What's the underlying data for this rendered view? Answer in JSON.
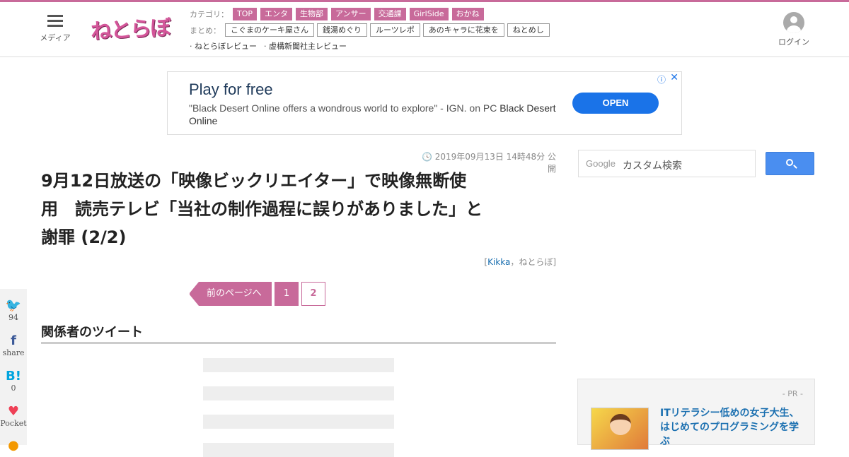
{
  "header": {
    "menu_label": "メディア",
    "logo_text": "ねとらぼ",
    "category_key": "カテゴリ：",
    "categories": [
      "TOP",
      "エンタ",
      "生物部",
      "アンサー",
      "交通課",
      "GirlSide",
      "おかね"
    ],
    "matome_key": "まとめ：",
    "matome": [
      "こぐまのケーキ屋さん",
      "銭湯めぐり",
      "ルーツレポ",
      "あのキャラに花束を",
      "ねとめし"
    ],
    "links": [
      "· ねとらぼレビュー",
      "· 虚構新聞社主レビュー"
    ],
    "login_label": "ログイン"
  },
  "ad": {
    "title": "Play for free",
    "desc_quote": "\"Black Desert Online offers a wondrous world to explore\" - IGN. on PC",
    "desc_brand": "Black Desert Online",
    "cta": "OPEN",
    "info_icon": "ⓘ",
    "close_icon": "✕"
  },
  "article": {
    "date": "2019年09月13日 14時48分 公開",
    "title_lines": [
      "9月12日放送の「映像ビックリエイター」で映像無断使",
      "用　読売テレビ「当社の制作過程に誤りがありました」と",
      "謝罪 (2/2)"
    ],
    "byline_open": "[",
    "byline_author": "Kikka",
    "byline_rest": "，ねとらぼ]",
    "prev_label": "前のページへ",
    "pages": [
      "1",
      "2"
    ],
    "section_title": "関係者のツイート"
  },
  "share": {
    "twitter_count": "94",
    "facebook_label": "share",
    "hatena_icon": "B!",
    "hatena_count": "0",
    "pocket_label": "Pocket"
  },
  "sidebar": {
    "search_brand": "Google",
    "search_placeholder": "カスタム検索",
    "pr_label": "- PR -",
    "pr_title": "ITリテラシー低めの女子大生、はじめてのプログラミングを学ぶ"
  },
  "colors": {
    "accent": "#c86a9a",
    "link": "#1a6fb0",
    "ad_button": "#1a73e8"
  }
}
